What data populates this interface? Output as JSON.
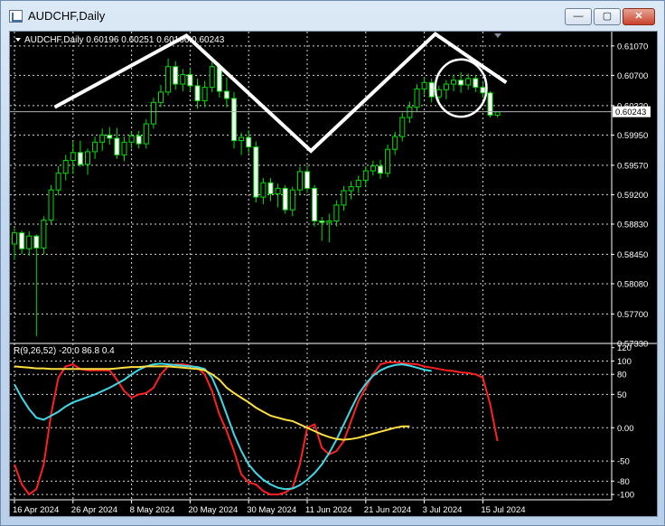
{
  "window": {
    "title": "AUDCHF,Daily",
    "buttons": {
      "minimize": "—",
      "maximize": "▢",
      "close": "✕"
    }
  },
  "chart_data": [
    {
      "type": "candlestick",
      "info_line": "AUDCHF,Daily  0.60196 0.60251 0.60166 0.60243",
      "price_ticks": [
        "0.61070",
        "0.60700",
        "0.60320",
        "0.59950",
        "0.59570",
        "0.59200",
        "0.58830",
        "0.58450",
        "0.58080",
        "0.57700",
        "0.57330"
      ],
      "price_tick_values": [
        0.6107,
        0.607,
        0.6032,
        0.5995,
        0.5957,
        0.592,
        0.5883,
        0.5845,
        0.5808,
        0.577,
        0.5733
      ],
      "ylim": [
        0.5733,
        0.6125
      ],
      "current_price": "0.60243",
      "current_price_value": 0.60243,
      "date_labels": [
        "16 Apr 2024",
        "26 Apr 2024",
        "8 May 2024",
        "20 May 2024",
        "30 May 2024",
        "11 Jun 2024",
        "21 Jun 2024",
        "3 Jul 2024",
        "15 Jul 2024"
      ],
      "date_label_index": [
        0,
        8,
        16,
        24,
        32,
        40,
        48,
        56,
        64
      ],
      "candles": [
        [
          0.5858,
          0.5878,
          0.5838,
          0.5872
        ],
        [
          0.5872,
          0.5875,
          0.5845,
          0.5852
        ],
        [
          0.5852,
          0.5874,
          0.5843,
          0.5868
        ],
        [
          0.5868,
          0.587,
          0.5742,
          0.5853
        ],
        [
          0.5853,
          0.5893,
          0.5845,
          0.5888
        ],
        [
          0.5888,
          0.5932,
          0.5884,
          0.5926
        ],
        [
          0.5926,
          0.5956,
          0.5919,
          0.5947
        ],
        [
          0.5947,
          0.597,
          0.5938,
          0.5963
        ],
        [
          0.5963,
          0.5987,
          0.5946,
          0.5973
        ],
        [
          0.5973,
          0.5988,
          0.5955,
          0.5958
        ],
        [
          0.5958,
          0.5978,
          0.5945,
          0.5974
        ],
        [
          0.5974,
          0.5993,
          0.5965,
          0.5986
        ],
        [
          0.5986,
          0.6003,
          0.5975,
          0.5995
        ],
        [
          0.5995,
          0.6005,
          0.5983,
          0.5991
        ],
        [
          0.5991,
          0.6004,
          0.5965,
          0.597
        ],
        [
          0.597,
          0.5993,
          0.5962,
          0.5986
        ],
        [
          0.5986,
          0.6,
          0.5978,
          0.5994
        ],
        [
          0.5994,
          0.6,
          0.5978,
          0.5984
        ],
        [
          0.5984,
          0.6015,
          0.5978,
          0.6009
        ],
        [
          0.6009,
          0.6042,
          0.6003,
          0.6036
        ],
        [
          0.6036,
          0.6058,
          0.603,
          0.6049
        ],
        [
          0.6049,
          0.6091,
          0.6045,
          0.6081
        ],
        [
          0.6081,
          0.6088,
          0.6052,
          0.6059
        ],
        [
          0.6059,
          0.6078,
          0.605,
          0.6071
        ],
        [
          0.6071,
          0.608,
          0.605,
          0.6057
        ],
        [
          0.6057,
          0.6066,
          0.6028,
          0.6038
        ],
        [
          0.6038,
          0.6063,
          0.603,
          0.6055
        ],
        [
          0.6055,
          0.6087,
          0.6049,
          0.6081
        ],
        [
          0.6081,
          0.6085,
          0.6042,
          0.605
        ],
        [
          0.605,
          0.6067,
          0.603,
          0.6041
        ],
        [
          0.6041,
          0.6049,
          0.5978,
          0.5988
        ],
        [
          0.5988,
          0.5998,
          0.597,
          0.5992
        ],
        [
          0.5992,
          0.6001,
          0.5972,
          0.598
        ],
        [
          0.598,
          0.5987,
          0.591,
          0.5917
        ],
        [
          0.5917,
          0.5941,
          0.5908,
          0.5935
        ],
        [
          0.5935,
          0.5941,
          0.5912,
          0.5921
        ],
        [
          0.5921,
          0.5934,
          0.5904,
          0.5928
        ],
        [
          0.5928,
          0.5932,
          0.5896,
          0.5901
        ],
        [
          0.5901,
          0.593,
          0.5893,
          0.5926
        ],
        [
          0.5926,
          0.5955,
          0.592,
          0.5949
        ],
        [
          0.5949,
          0.5957,
          0.5922,
          0.5928
        ],
        [
          0.5928,
          0.5932,
          0.588,
          0.5887
        ],
        [
          0.5887,
          0.5892,
          0.5862,
          0.5885
        ],
        [
          0.5885,
          0.5896,
          0.586,
          0.5887
        ],
        [
          0.5887,
          0.5913,
          0.588,
          0.5907
        ],
        [
          0.5907,
          0.5931,
          0.59,
          0.5925
        ],
        [
          0.5925,
          0.5937,
          0.5914,
          0.593
        ],
        [
          0.593,
          0.5944,
          0.5922,
          0.5938
        ],
        [
          0.5938,
          0.5956,
          0.5931,
          0.595
        ],
        [
          0.595,
          0.5963,
          0.5944,
          0.5956
        ],
        [
          0.5956,
          0.5964,
          0.594,
          0.5947
        ],
        [
          0.5947,
          0.5983,
          0.5942,
          0.5977
        ],
        [
          0.5977,
          0.5999,
          0.597,
          0.5993
        ],
        [
          0.5993,
          0.6023,
          0.5987,
          0.6017
        ],
        [
          0.6017,
          0.6037,
          0.601,
          0.603
        ],
        [
          0.603,
          0.6059,
          0.6024,
          0.6053
        ],
        [
          0.6053,
          0.6068,
          0.6046,
          0.6061
        ],
        [
          0.6061,
          0.6066,
          0.6036,
          0.6043
        ],
        [
          0.6043,
          0.6057,
          0.6036,
          0.6052
        ],
        [
          0.6052,
          0.6064,
          0.604,
          0.6059
        ],
        [
          0.6059,
          0.6071,
          0.605,
          0.6064
        ],
        [
          0.6064,
          0.6074,
          0.6048,
          0.6058
        ],
        [
          0.6058,
          0.6072,
          0.6052,
          0.6066
        ],
        [
          0.6066,
          0.607,
          0.6049,
          0.6055
        ],
        [
          0.6055,
          0.6063,
          0.6042,
          0.6048
        ],
        [
          0.6048,
          0.605,
          0.6017,
          0.602
        ],
        [
          0.602,
          0.6025,
          0.6017,
          0.6024
        ]
      ],
      "annotations": {
        "zigzag": [
          [
            5.5,
            0.603
          ],
          [
            23.5,
            0.612
          ],
          [
            40.5,
            0.5975
          ],
          [
            57.5,
            0.6122
          ],
          [
            67.2,
            0.6061
          ]
        ],
        "circle": {
          "center_index": 61,
          "center_price": 0.6054,
          "radius_index": 3.5,
          "radius_price": 0.0036
        }
      }
    },
    {
      "type": "line",
      "info_line": "R(9,26,52) -20.0 86.8 0.4",
      "y_ticks": [
        "120",
        "100",
        "80",
        "50",
        "0.00",
        "-50",
        "-80",
        "-100"
      ],
      "y_tick_values": [
        120,
        100,
        80,
        50,
        0,
        -50,
        -80,
        -100
      ],
      "ylim": [
        -108,
        125
      ],
      "grid_levels": [
        100,
        80,
        50,
        0,
        -50,
        -80,
        -100
      ],
      "series": [
        {
          "color": "#ff2020",
          "values": [
            -55,
            -85,
            -100,
            -92,
            -55,
            20,
            75,
            92,
            95,
            88,
            86,
            86,
            86,
            86,
            72,
            55,
            45,
            50,
            52,
            60,
            80,
            92,
            95,
            95,
            93,
            90,
            80,
            55,
            20,
            -5,
            -35,
            -70,
            -82,
            -85,
            -95,
            -100,
            -100,
            -97,
            -90,
            -55,
            0,
            5,
            -30,
            -40,
            -35,
            -20,
            10,
            40,
            60,
            80,
            95,
            98,
            98,
            97,
            96,
            95,
            92,
            90,
            88,
            86,
            85,
            83,
            82,
            80,
            75,
            35,
            -20
          ]
        },
        {
          "color": "#40d8e8",
          "values": [
            65,
            45,
            28,
            15,
            12,
            18,
            24,
            32,
            38,
            42,
            46,
            50,
            55,
            60,
            66,
            72,
            80,
            87,
            92,
            95,
            96,
            95,
            94,
            93,
            92,
            91,
            88,
            75,
            50,
            20,
            -10,
            -35,
            -55,
            -68,
            -78,
            -85,
            -90,
            -92,
            -91,
            -86,
            -78,
            -68,
            -55,
            -38,
            -18,
            5,
            28,
            50,
            66,
            78,
            86,
            91,
            94,
            95,
            93,
            90,
            87,
            85
          ]
        },
        {
          "color": "#ffe040",
          "values": [
            92,
            91,
            90,
            89,
            89,
            88,
            88,
            88,
            88,
            88,
            88,
            88,
            88,
            88,
            89,
            90,
            91,
            91,
            92,
            92,
            92,
            92,
            91,
            90,
            89,
            88,
            86,
            80,
            72,
            60,
            52,
            45,
            38,
            30,
            24,
            18,
            15,
            12,
            10,
            5,
            0,
            -5,
            -10,
            -14,
            -17,
            -18,
            -17,
            -15,
            -12,
            -9,
            -6,
            -3,
            0,
            2,
            2
          ]
        }
      ]
    }
  ]
}
